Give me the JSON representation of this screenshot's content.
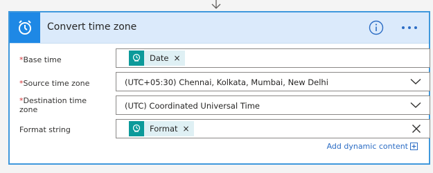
{
  "action": {
    "title": "Convert time zone",
    "icons": {
      "header": "alarm-clock-icon",
      "info": "info-icon",
      "more": "more-options-icon"
    }
  },
  "fields": {
    "base_time": {
      "required_mark": "*",
      "label": "Base time",
      "token": {
        "label": "Date",
        "remove": "×",
        "icon": "clock-token-icon"
      }
    },
    "source_time_zone": {
      "required_mark": "*",
      "label": "Source time zone",
      "value": "(UTC+05:30) Chennai, Kolkata, Mumbai, New Delhi"
    },
    "destination_time_zone": {
      "required_mark": "*",
      "label_line1": "Destination time",
      "label_line2": "zone",
      "value": "(UTC) Coordinated Universal Time"
    },
    "format_string": {
      "label": "Format string",
      "token": {
        "label": "Format",
        "remove": "×",
        "icon": "clock-token-icon"
      }
    }
  },
  "add_dynamic_content": "Add dynamic content",
  "colors": {
    "accent": "#1e88e5",
    "header_bg": "#dbeafb",
    "token_icon": "#0c9a9a",
    "token_bg": "#dff0f4",
    "required": "#d13438",
    "link": "#2b6cc4"
  }
}
